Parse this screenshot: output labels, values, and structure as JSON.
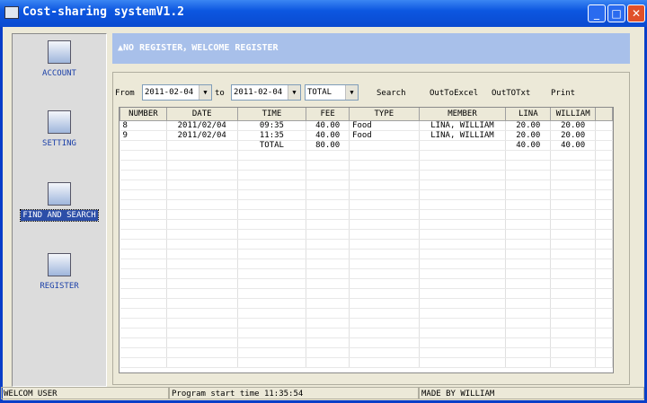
{
  "window": {
    "title": "Cost-sharing systemV1.2"
  },
  "sidebar": {
    "items": [
      {
        "label": "ACCOUNT",
        "icon": "account-icon"
      },
      {
        "label": "SETTING",
        "icon": "setting-icon"
      },
      {
        "label": "FIND AND SEARCH",
        "icon": "find-icon",
        "active": true
      },
      {
        "label": "REGISTER",
        "icon": "register-icon"
      }
    ]
  },
  "banner": {
    "text": "▲NO REGISTER，WELCOME REGISTER"
  },
  "toolbar": {
    "from_label": "From",
    "from_value": "2011-02-04",
    "to_label": "to",
    "to_value": "2011-02-04",
    "type_value": "TOTAL",
    "search": "Search",
    "excel": "OutToExcel",
    "txt": "OutTOTxt",
    "print": "Print"
  },
  "table": {
    "columns": [
      "NUMBER",
      "DATE",
      "TIME",
      "FEE",
      "TYPE",
      "MEMBER",
      "LINA",
      "WILLIAM"
    ],
    "rows": [
      [
        "8",
        "2011/02/04",
        "09:35",
        "40.00",
        "Food",
        "LINA, WILLIAM",
        "20.00",
        "20.00"
      ],
      [
        "9",
        "2011/02/04",
        "11:35",
        "40.00",
        "Food",
        "LINA, WILLIAM",
        "20.00",
        "20.00"
      ],
      [
        "",
        "",
        "TOTAL",
        "80.00",
        "",
        "",
        "40.00",
        "40.00"
      ]
    ]
  },
  "status": {
    "left": "WELCOM USER",
    "middle": "Program start time 11:35:54",
    "right": "MADE BY WILLIAM"
  }
}
